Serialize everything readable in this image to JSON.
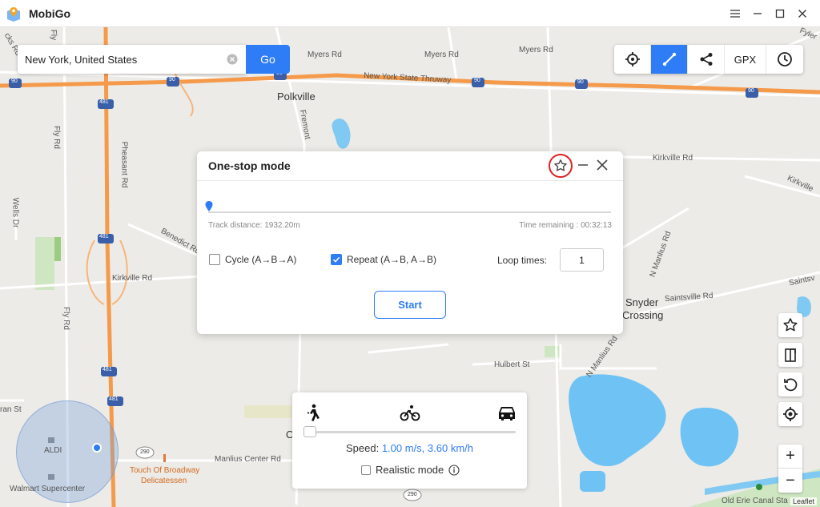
{
  "app": {
    "title": "MobiGo",
    "brand_color": "#2e7cf6"
  },
  "window_controls": [
    "menu-icon",
    "minimize-icon",
    "maximize-icon",
    "close-icon"
  ],
  "search": {
    "value": "New York, United States",
    "go_label": "Go"
  },
  "toolbar": {
    "items": [
      "crosshair-icon",
      "route-icon",
      "share-icon",
      "GPX",
      "clock-icon"
    ],
    "gpx_label": "GPX",
    "active": "route-icon"
  },
  "map": {
    "places": [
      "Polkville",
      "Snyder",
      "Crossing",
      "ALDI",
      "Walmart Supercenter",
      "Touch Of Broadway",
      "Delicatessen"
    ],
    "roads": [
      "Myers Rd",
      "Myers Rd",
      "Myers Rd",
      "New York State Thruway",
      "Kirkville Rd",
      "Kirkville Rd",
      "Fly Rd",
      "Pheasant Rd",
      "Fremont",
      "Wells Dr",
      "Benedict Rd",
      "Fly Rd",
      "Hulbert St",
      "Manlius Center Rd",
      "N Manlius Rd",
      "N Manlius Rd",
      "Saintsville Rd",
      "Saintsv",
      "Kirkville",
      "Fyler",
      "Old Erie Canal Sta",
      "ran St",
      "O",
      "Fly",
      "cks Rd"
    ],
    "shields": [
      "90",
      "90",
      "90",
      "90",
      "90",
      "90",
      "481",
      "481",
      "481",
      "481",
      "290",
      "290"
    ],
    "attribution": "Leaflet"
  },
  "dialog": {
    "title": "One-stop mode",
    "track_distance": "Track distance: 1932.20m",
    "time_remaining": "Time remaining : 00:32:13",
    "cycle_label": "Cycle (A→B→A)",
    "cycle_checked": false,
    "repeat_label": "Repeat (A→B, A→B)",
    "repeat_checked": true,
    "loop_label": "Loop times:",
    "loop_value": "1",
    "start_label": "Start",
    "progress": 0
  },
  "speed": {
    "label": "Speed:",
    "value": "1.00 m/s, 3.60 km/h",
    "realistic_label": "Realistic mode",
    "realistic_checked": false,
    "modes": [
      "walk-icon",
      "bike-icon",
      "car-icon"
    ]
  },
  "side_buttons": [
    "star-icon",
    "copy-icon",
    "reset-icon",
    "locate-icon"
  ],
  "zoom": {
    "in": "+",
    "out": "−"
  }
}
